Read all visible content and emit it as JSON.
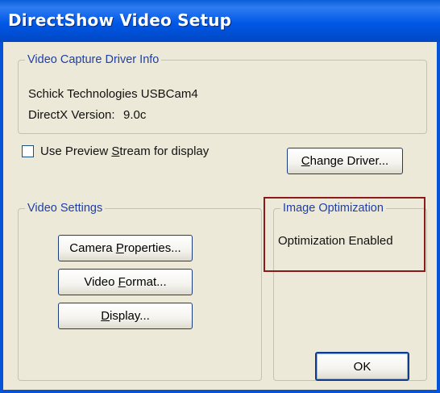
{
  "window": {
    "title": "DirectShow Video Setup"
  },
  "driver_info": {
    "legend": "Video Capture Driver Info",
    "driver_name": "Schick Technologies USBCam4",
    "directx_label": "DirectX Version:",
    "directx_value": "9.0c"
  },
  "preview": {
    "checkbox_label": "Use Preview Stream for display",
    "checked": false
  },
  "buttons": {
    "change_driver": "Change Driver...",
    "camera_properties": "Camera Properties...",
    "video_format": "Video Format...",
    "display": "Display...",
    "ok": "OK"
  },
  "video_settings": {
    "legend": "Video Settings"
  },
  "image_optimization": {
    "legend": "Image Optimization",
    "status": "Optimization Enabled"
  },
  "colors": {
    "titlebar": "#0058e6",
    "legend_text": "#1f3fa8",
    "highlight_border": "#8b1a1a",
    "dialog_background": "#ece9d8"
  }
}
